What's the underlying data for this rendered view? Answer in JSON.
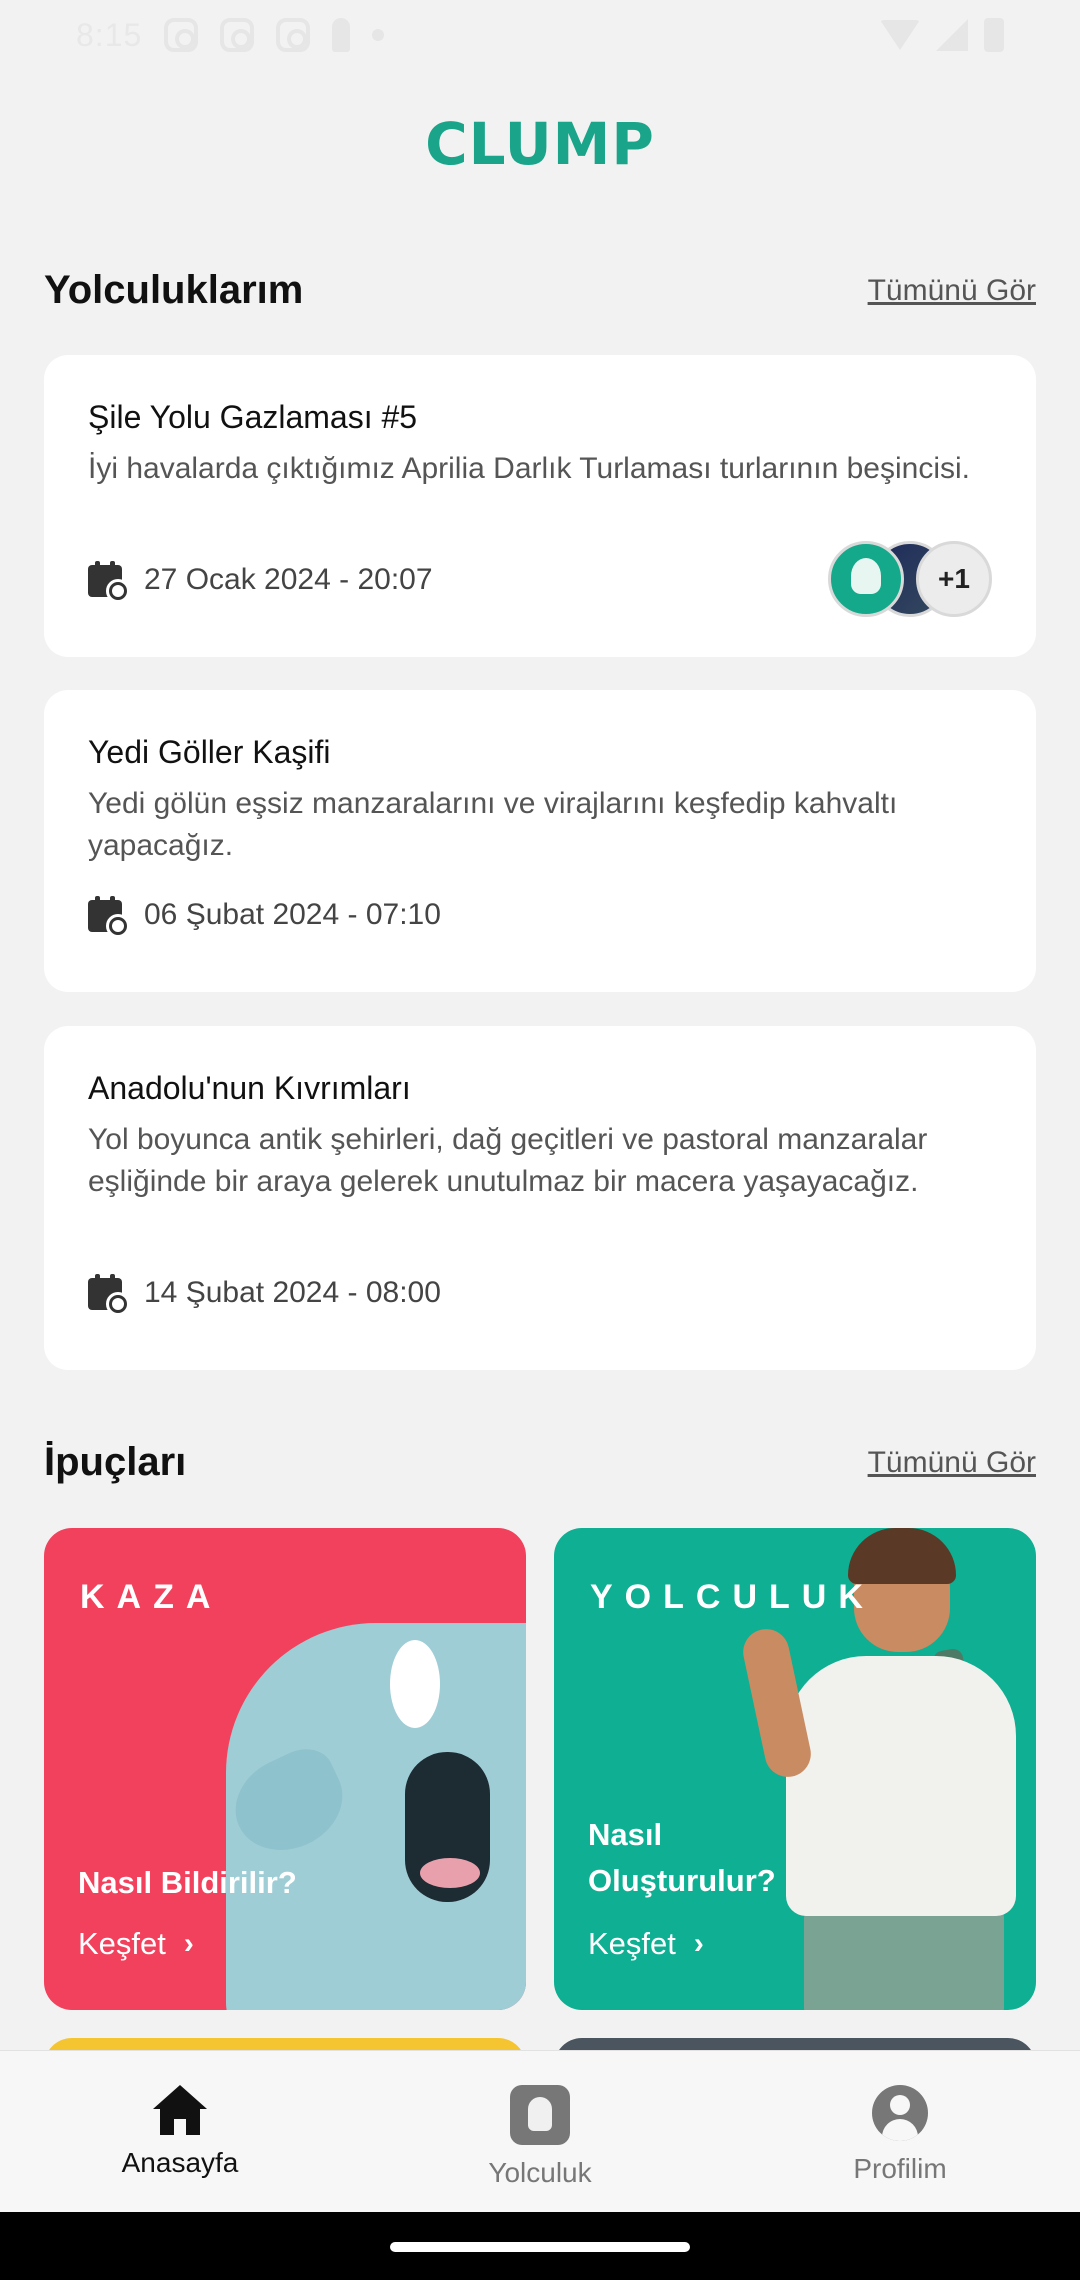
{
  "status_bar": {
    "time": "8:15"
  },
  "app": {
    "logo": "CLUMP"
  },
  "trips_section": {
    "title": "Yolculuklarım",
    "see_all": "Tümünü Gör",
    "items": [
      {
        "title": "Şile Yolu Gazlaması #5",
        "description": "İyi havalarda çıktığımız Aprilia Darlık Turlaması turlarının beşincisi.",
        "date": "27 Ocak 2024 - 20:07",
        "participants_more": "+1"
      },
      {
        "title": "Yedi Göller Kaşifi",
        "description": "Yedi gölün eşsiz manzaralarını ve virajlarını keşfedip kahvaltı yapacağız.",
        "date": "06 Şubat 2024 - 07:10"
      },
      {
        "title": "Anadolu'nun Kıvrımları",
        "description": "Yol boyunca antik şehirleri, dağ geçitleri ve pastoral manzaralar eşliğinde bir araya gelerek unutulmaz bir macera yaşayacağız.",
        "date": "14 Şubat 2024 - 08:00"
      }
    ]
  },
  "tips_section": {
    "title": "İpuçları",
    "see_all": "Tümünü Gör",
    "cards": [
      {
        "label": "KAZA",
        "heading": "Nasıl Bildirilir?",
        "cta": "Keşfet",
        "color": "#f2415c"
      },
      {
        "label": "YOLCULUK",
        "heading": "Nasıl Oluşturulur?",
        "cta": "Keşfet",
        "color": "#0eaf92"
      }
    ]
  },
  "bottom_nav": {
    "items": [
      {
        "label": "Anasayfa",
        "icon": "home-icon",
        "active": true
      },
      {
        "label": "Yolculuk",
        "icon": "trip-icon",
        "active": false
      },
      {
        "label": "Profilim",
        "icon": "profile-icon",
        "active": false
      }
    ]
  },
  "colors": {
    "brand": "#1aa58a",
    "accent_red": "#f2415c",
    "accent_green": "#0eaf92"
  }
}
